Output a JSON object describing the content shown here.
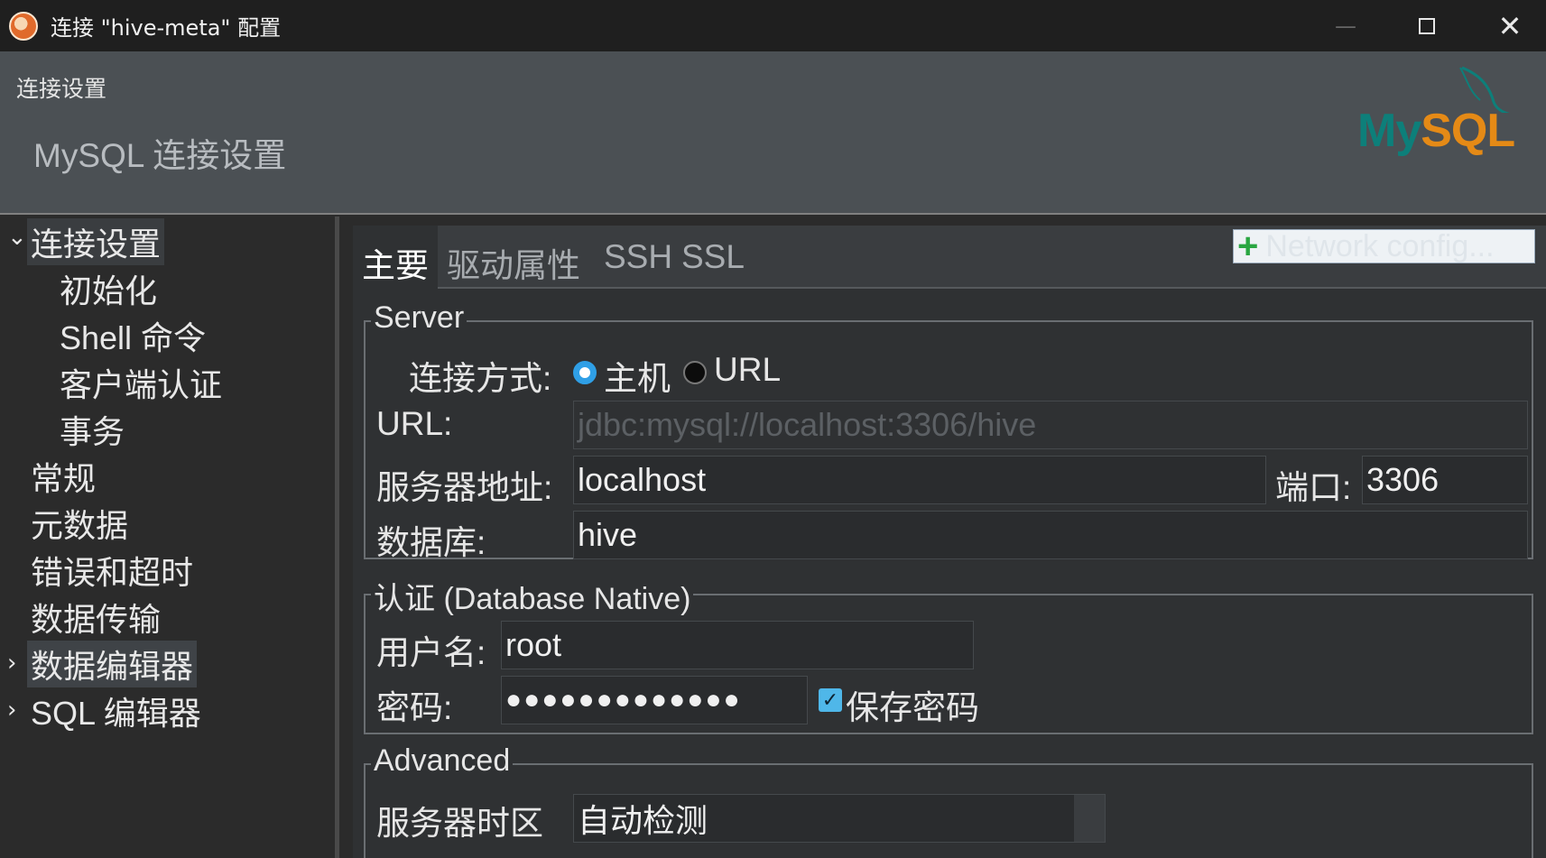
{
  "window": {
    "title": "连接 \"hive-meta\" 配置"
  },
  "banner": {
    "section": "连接设置",
    "title": "MySQL 连接设置",
    "logo_my": "My",
    "logo_sql": "SQL"
  },
  "sidebar": {
    "items": [
      {
        "label": "连接设置",
        "expanded": true,
        "selected": false
      },
      {
        "label": "初始化"
      },
      {
        "label": "Shell 命令"
      },
      {
        "label": "客户端认证"
      },
      {
        "label": "事务"
      },
      {
        "label": "常规"
      },
      {
        "label": "元数据"
      },
      {
        "label": "错误和超时"
      },
      {
        "label": "数据传输"
      },
      {
        "label": "数据编辑器",
        "expandable": true,
        "selected": true
      },
      {
        "label": "SQL 编辑器",
        "expandable": true
      }
    ]
  },
  "tabs": [
    {
      "label": "主要",
      "active": true
    },
    {
      "label": "驱动属性"
    },
    {
      "label": "SSH"
    },
    {
      "label": "SSL"
    }
  ],
  "network_config": {
    "label": "Network config..."
  },
  "server": {
    "legend": "Server",
    "connection_mode_label": "连接方式:",
    "mode_host_label": "主机",
    "mode_url_label": "URL",
    "mode_selected": "主机",
    "url_label": "URL:",
    "url_value": "jdbc:mysql://localhost:3306/hive",
    "host_label": "服务器地址:",
    "host_value": "localhost",
    "port_label": "端口:",
    "port_value": "3306",
    "database_label": "数据库:",
    "database_value": "hive"
  },
  "auth": {
    "legend": "认证 (Database Native)",
    "username_label": "用户名:",
    "username_value": "root",
    "password_label": "密码:",
    "password_value": "●●●●●●●●●●●●●",
    "save_password_label": "保存密码",
    "save_password_checked": true
  },
  "advanced": {
    "legend": "Advanced",
    "timezone_label": "服务器时区",
    "timezone_value": "自动检测"
  }
}
